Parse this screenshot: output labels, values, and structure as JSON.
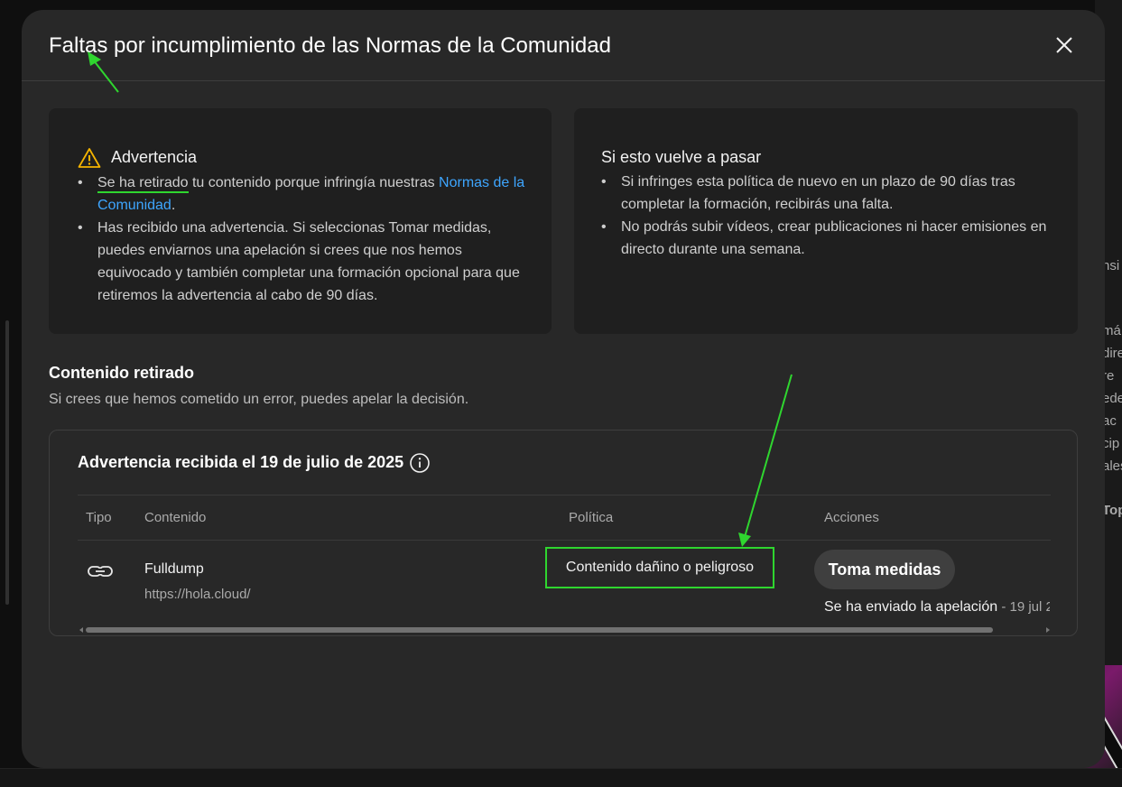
{
  "background": {
    "peek_lines": [
      "nsi",
      "má",
      "dire",
      "re",
      "ede",
      "ac",
      "cip",
      "ales",
      "Top"
    ]
  },
  "modal": {
    "title": "Faltas por incumplimiento de las Normas de la Comunidad",
    "close_icon": "close-icon"
  },
  "warning_card": {
    "icon": "warning-triangle-icon",
    "heading": "Advertencia",
    "bullet1": {
      "highlight": "Se ha retirado",
      "text": " tu contenido porque infringía nuestras ",
      "link": "Normas de la Comunidad",
      "end": "."
    },
    "bullet2": "Has recibido una advertencia. Si seleccionas Tomar medidas, puedes enviarnos una apelación si crees que nos hemos equivocado y también completar una formación opcional para que retiremos la advertencia al cabo de 90 días."
  },
  "next_card": {
    "heading": "Si esto vuelve a pasar",
    "bullets": [
      "Si infringes esta política de nuevo en un plazo de 90 días tras completar la formación, recibirás una falta.",
      "No podrás subir vídeos, crear publicaciones ni hacer emisiones en directo durante una semana."
    ]
  },
  "removed": {
    "title": "Contenido retirado",
    "subtitle": "Si crees que hemos cometido un error, puedes apelar la decisión."
  },
  "strike": {
    "title": "Advertencia recibida el 19 de julio de 2025",
    "info_icon": "info-icon",
    "columns": {
      "tipo": "Tipo",
      "contenido": "Contenido",
      "politica": "Política",
      "acciones": "Acciones"
    },
    "row": {
      "type_icon": "link-icon",
      "title": "Fulldump",
      "url": "https://hola.cloud/",
      "policy": "Contenido dañino o peligroso",
      "action_label": "Toma medidas",
      "appeal_text": "Se ha enviado la apelación",
      "appeal_date": " - 19 jul 2"
    }
  },
  "annotation_color": "#2fd62f"
}
